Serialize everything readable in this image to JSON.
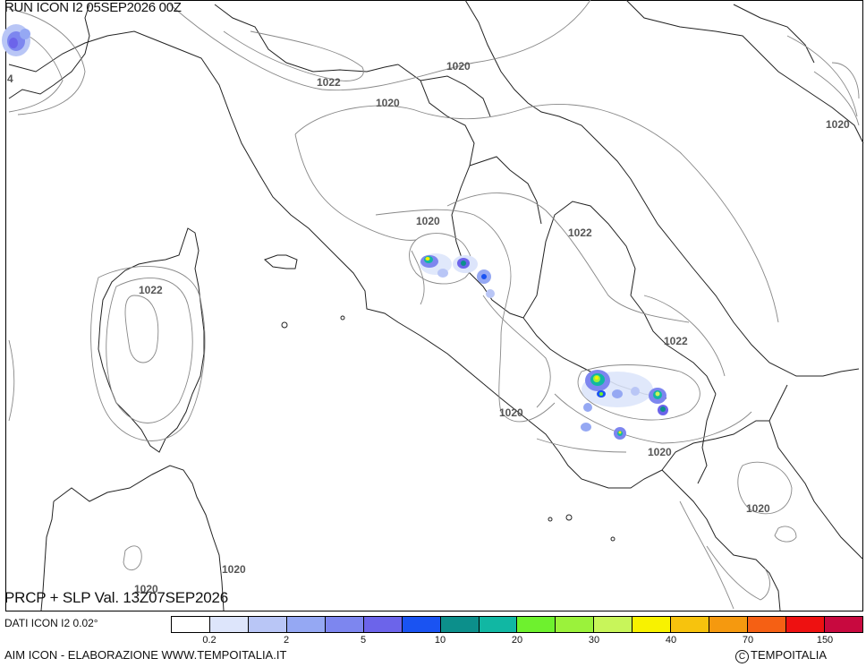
{
  "header": {
    "run_title": "RUN ICON I2 05SEP2026 00Z"
  },
  "map": {
    "isobar_labels": [
      "1020",
      "1022",
      "1020",
      "1020",
      "1022",
      "1022",
      "1022",
      "1020",
      "1020",
      "1020",
      "1020",
      "1020",
      "1020",
      "1020"
    ],
    "partial_label_left": "4"
  },
  "footer": {
    "product_title": "PRCP + SLP Val. 13Z07SEP2026",
    "dati": "DATI ICON I2 0.02°",
    "credit": "AIM ICON - ELABORAZIONE WWW.TEMPOITALIA.IT",
    "copyright": "TEMPOITALIA",
    "copyright_symbol": "C"
  },
  "legend": {
    "colors": [
      "#ffffff",
      "#dde5fb",
      "#b9c6f6",
      "#95a8f3",
      "#7d86ef",
      "#6c64ea",
      "#1a53f2",
      "#0c8f8b",
      "#11b7a3",
      "#6ef12e",
      "#9bf23b",
      "#c8f55a",
      "#f8f200",
      "#f7c30d",
      "#f5990f",
      "#f56014",
      "#ee1111",
      "#c8093f"
    ],
    "tick_labels": [
      "0.2",
      "2",
      "5",
      "10",
      "20",
      "30",
      "40",
      "70",
      "150"
    ]
  }
}
